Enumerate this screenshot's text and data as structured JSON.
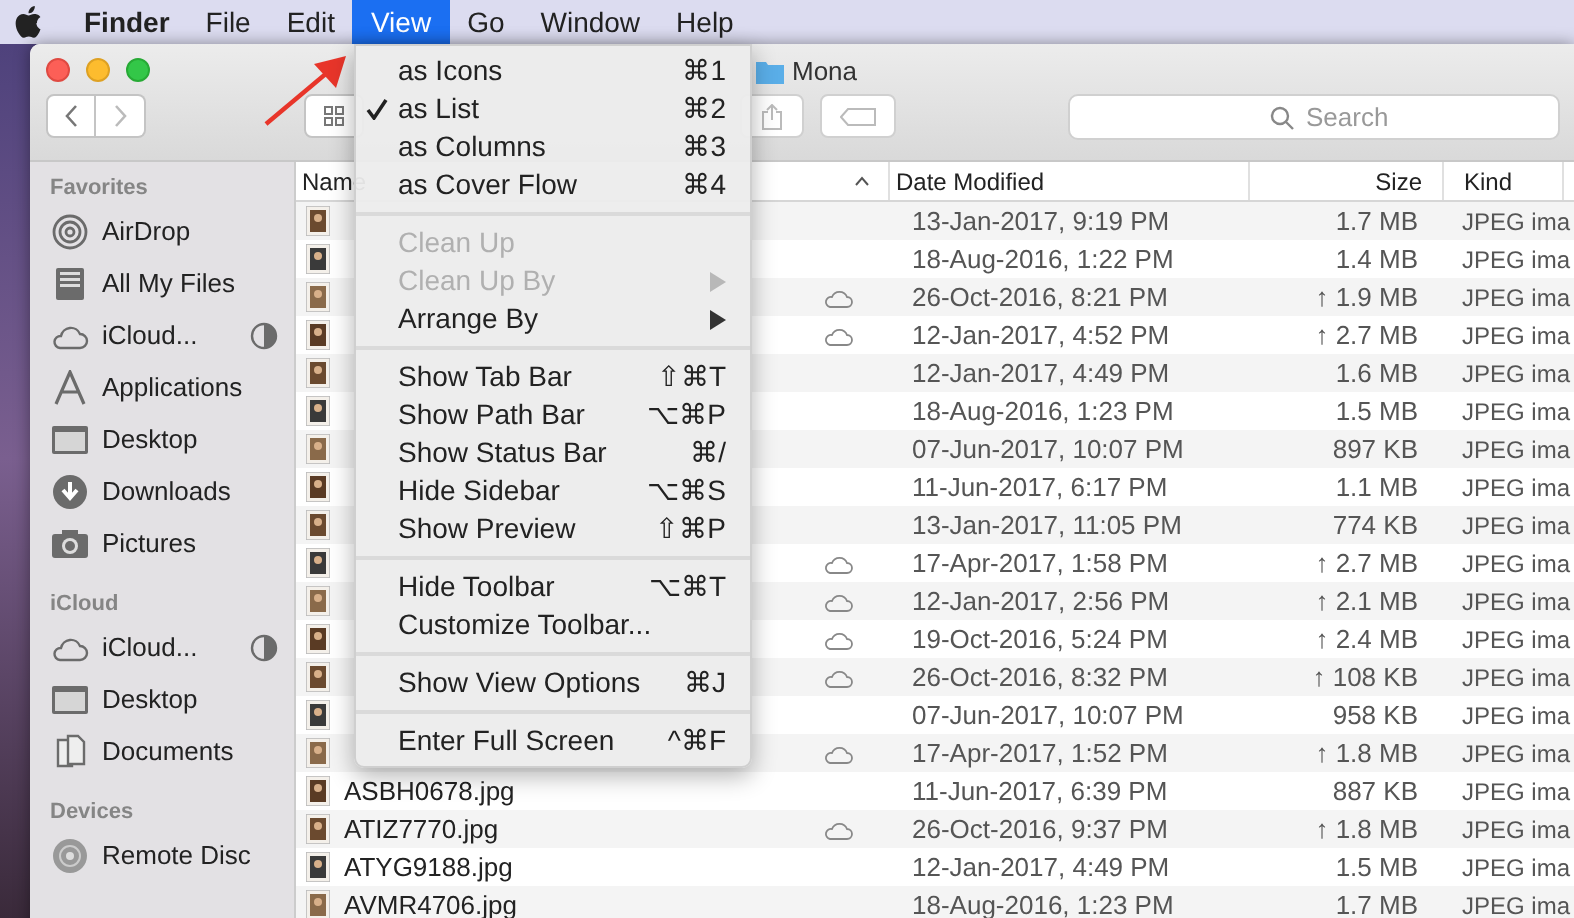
{
  "menubar": {
    "items": [
      {
        "label": "Finder",
        "bold": true,
        "selected": false
      },
      {
        "label": "File",
        "selected": false
      },
      {
        "label": "Edit",
        "selected": false
      },
      {
        "label": "View",
        "selected": true
      },
      {
        "label": "Go",
        "selected": false
      },
      {
        "label": "Window",
        "selected": false
      },
      {
        "label": "Help",
        "selected": false
      }
    ]
  },
  "window": {
    "title": "Mona",
    "search": {
      "placeholder": "Search"
    }
  },
  "sidebar": [
    {
      "heading": "Favorites",
      "items": [
        {
          "label": "AirDrop",
          "kind": "airdrop",
          "syncing": false
        },
        {
          "label": "All My Files",
          "kind": "files",
          "syncing": false
        },
        {
          "label": "iCloud...",
          "kind": "cloud",
          "syncing": true
        },
        {
          "label": "Applications",
          "kind": "apps",
          "syncing": false
        },
        {
          "label": "Desktop",
          "kind": "desktop",
          "syncing": false
        },
        {
          "label": "Downloads",
          "kind": "downloads",
          "syncing": false
        },
        {
          "label": "Pictures",
          "kind": "pictures",
          "syncing": false
        }
      ]
    },
    {
      "heading": "iCloud",
      "items": [
        {
          "label": "iCloud...",
          "kind": "cloud",
          "syncing": true
        },
        {
          "label": "Desktop",
          "kind": "desktop",
          "syncing": false
        },
        {
          "label": "Documents",
          "kind": "documents",
          "syncing": false
        }
      ]
    },
    {
      "heading": "Devices",
      "items": [
        {
          "label": "Remote Disc",
          "kind": "disc",
          "syncing": false
        }
      ]
    }
  ],
  "table": {
    "columns": [
      {
        "label": "Name",
        "sorted": true
      },
      {
        "label": "Date Modified",
        "sorted": false
      },
      {
        "label": "Size",
        "sorted": false
      },
      {
        "label": "Kind",
        "sorted": false
      }
    ],
    "rows": [
      {
        "date": "13-Jan-2017, 9:19 PM",
        "size": "1.7 MB",
        "kind": "JPEG ima",
        "in_cloud": false
      },
      {
        "date": "18-Aug-2016, 1:22 PM",
        "size": "1.4 MB",
        "kind": "JPEG ima",
        "in_cloud": false
      },
      {
        "date": "26-Oct-2016, 8:21 PM",
        "size": "↑ 1.9 MB",
        "kind": "JPEG ima",
        "in_cloud": true
      },
      {
        "date": "12-Jan-2017, 4:52 PM",
        "size": "↑ 2.7 MB",
        "kind": "JPEG ima",
        "in_cloud": true
      },
      {
        "date": "12-Jan-2017, 4:49 PM",
        "size": "1.6 MB",
        "kind": "JPEG ima",
        "in_cloud": false
      },
      {
        "date": "18-Aug-2016, 1:23 PM",
        "size": "1.5 MB",
        "kind": "JPEG ima",
        "in_cloud": false
      },
      {
        "date": "07-Jun-2017, 10:07 PM",
        "size": "897 KB",
        "kind": "JPEG ima",
        "in_cloud": false
      },
      {
        "date": "11-Jun-2017, 6:17 PM",
        "size": "1.1 MB",
        "kind": "JPEG ima",
        "in_cloud": false
      },
      {
        "date": "13-Jan-2017, 11:05 PM",
        "size": "774 KB",
        "kind": "JPEG ima",
        "in_cloud": false
      },
      {
        "date": "17-Apr-2017, 1:58 PM",
        "size": "↑ 2.7 MB",
        "kind": "JPEG ima",
        "in_cloud": true
      },
      {
        "date": "12-Jan-2017, 2:56 PM",
        "size": "↑ 2.1 MB",
        "kind": "JPEG ima",
        "in_cloud": true
      },
      {
        "date": "19-Oct-2016, 5:24 PM",
        "size": "↑ 2.4 MB",
        "kind": "JPEG ima",
        "in_cloud": true
      },
      {
        "date": "26-Oct-2016, 8:32 PM",
        "size": "↑ 108 KB",
        "kind": "JPEG ima",
        "in_cloud": true
      },
      {
        "date": "07-Jun-2017, 10:07 PM",
        "size": "958 KB",
        "kind": "JPEG ima",
        "in_cloud": false
      },
      {
        "date": "17-Apr-2017, 1:52 PM",
        "size": "↑ 1.8 MB",
        "kind": "JPEG ima",
        "in_cloud": true
      },
      {
        "name": "ASBH0678.jpg",
        "date": "11-Jun-2017, 6:39 PM",
        "size": "887 KB",
        "kind": "JPEG ima",
        "in_cloud": false
      },
      {
        "name": "ATIZ7770.jpg",
        "date": "26-Oct-2016, 9:37 PM",
        "size": "↑ 1.8 MB",
        "kind": "JPEG ima",
        "in_cloud": true
      },
      {
        "name": "ATYG9188.jpg",
        "date": "12-Jan-2017, 4:49 PM",
        "size": "1.5 MB",
        "kind": "JPEG ima",
        "in_cloud": false
      },
      {
        "name": "AVMR4706.jpg",
        "date": "18-Aug-2016, 1:23 PM",
        "size": "1.7 MB",
        "kind": "JPEG ima",
        "in_cloud": false
      }
    ]
  },
  "menu": {
    "items": [
      {
        "kind": "item",
        "label": "as Icons",
        "shortcut": "⌘1",
        "checked": false,
        "disabled": false
      },
      {
        "kind": "item",
        "label": "as List",
        "shortcut": "⌘2",
        "checked": true,
        "disabled": false
      },
      {
        "kind": "item",
        "label": "as Columns",
        "shortcut": "⌘3",
        "checked": false,
        "disabled": false
      },
      {
        "kind": "item",
        "label": "as Cover Flow",
        "shortcut": "⌘4",
        "checked": false,
        "disabled": false
      },
      {
        "kind": "separator"
      },
      {
        "kind": "item",
        "label": "Clean Up",
        "checked": false,
        "disabled": true
      },
      {
        "kind": "item",
        "label": "Clean Up By",
        "submenu": true,
        "checked": false,
        "disabled": true
      },
      {
        "kind": "item",
        "label": "Arrange By",
        "submenu": true,
        "checked": false,
        "disabled": false
      },
      {
        "kind": "separator"
      },
      {
        "kind": "item",
        "label": "Show Tab Bar",
        "shortcut": "⇧⌘T",
        "checked": false,
        "disabled": false
      },
      {
        "kind": "item",
        "label": "Show Path Bar",
        "shortcut": "⌥⌘P",
        "checked": false,
        "disabled": false
      },
      {
        "kind": "item",
        "label": "Show Status Bar",
        "shortcut": "⌘/",
        "checked": false,
        "disabled": false
      },
      {
        "kind": "item",
        "label": "Hide Sidebar",
        "shortcut": "⌥⌘S",
        "checked": false,
        "disabled": false
      },
      {
        "kind": "item",
        "label": "Show Preview",
        "shortcut": "⇧⌘P",
        "checked": false,
        "disabled": false
      },
      {
        "kind": "separator"
      },
      {
        "kind": "item",
        "label": "Hide Toolbar",
        "shortcut": "⌥⌘T",
        "checked": false,
        "disabled": false
      },
      {
        "kind": "item",
        "label": "Customize Toolbar...",
        "checked": false,
        "disabled": false
      },
      {
        "kind": "separator"
      },
      {
        "kind": "item",
        "label": "Show View Options",
        "shortcut": "⌘J",
        "checked": false,
        "disabled": false
      },
      {
        "kind": "separator"
      },
      {
        "kind": "item",
        "label": "Enter Full Screen",
        "shortcut": "^⌘F",
        "checked": false,
        "disabled": false
      }
    ]
  }
}
